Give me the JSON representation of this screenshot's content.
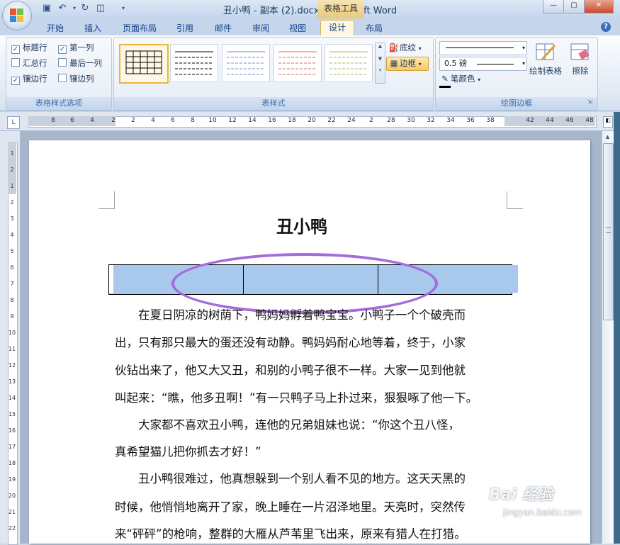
{
  "window": {
    "title": "丑小鸭 - 副本 (2).docx - Microsoft Word",
    "context_tab": "表格工具"
  },
  "ribbon_tabs": [
    {
      "label": "开始"
    },
    {
      "label": "插入"
    },
    {
      "label": "页面布局"
    },
    {
      "label": "引用"
    },
    {
      "label": "邮件"
    },
    {
      "label": "审阅"
    },
    {
      "label": "视图"
    },
    {
      "label": "设计"
    },
    {
      "label": "布局"
    }
  ],
  "active_tab": "设计",
  "groups": {
    "style_options": {
      "label": "表格样式选项",
      "checkboxes": [
        {
          "label": "标题行",
          "checked": "✓"
        },
        {
          "label": "第一列",
          "checked": "✓"
        },
        {
          "label": "汇总行",
          "checked": ""
        },
        {
          "label": "最后一列",
          "checked": ""
        },
        {
          "label": "镶边行",
          "checked": "✓"
        },
        {
          "label": "镶边列",
          "checked": ""
        }
      ]
    },
    "table_styles": {
      "label": "表样式",
      "shading": "底纹",
      "borders": "边框"
    },
    "draw_borders": {
      "label": "绘图边框",
      "line_weight": "0.5 磅",
      "pen_color": "笔颜色",
      "draw_table": "绘制表格",
      "eraser": "擦除"
    }
  },
  "ruler": {
    "h_numbers": [
      "8",
      "6",
      "4",
      "2",
      "2",
      "4",
      "6",
      "8",
      "10",
      "12",
      "14",
      "16",
      "18",
      "20",
      "22",
      "24",
      "2",
      "28",
      "30",
      "32",
      "34",
      "36",
      "38",
      "42",
      "44",
      "46",
      "48"
    ],
    "v_numbers": [
      "1",
      "2",
      "1",
      "2",
      "3",
      "4",
      "5",
      "6",
      "7",
      "8",
      "9",
      "10",
      "11",
      "12",
      "13",
      "14",
      "15",
      "16",
      "17",
      "18",
      "19",
      "20",
      "21",
      "22"
    ]
  },
  "document": {
    "heading": "丑小鸭",
    "table_columns": 3,
    "paragraphs": [
      "　　在夏日阴凉的树荫下，鸭妈妈孵着鸭宝宝。小鸭子一个个破壳而",
      "出，只有那只最大的蛋还没有动静。鸭妈妈耐心地等着，终于，小家",
      "伙钻出来了，他又大又丑，和别的小鸭子很不一样。大家一见到他就",
      "叫起来：“瞧，他多丑啊！”有一只鸭子马上扑过来，狠狠啄了他一下。",
      "　　大家都不喜欢丑小鸭，连他的兄弟姐妹也说：“你这个丑八怪，",
      "真希望猫儿把你抓去才好！”",
      "　　丑小鸭很难过，他真想躲到一个别人看不见的地方。这天天黑的",
      "时候，他悄悄地离开了家，晚上睡在一片沼泽地里。天亮时，突然传",
      "来“砰砰”的枪响，整群的大雁从芦苇里飞出来，原来有猎人在打猎。"
    ]
  },
  "watermark": {
    "logo": "Bai 经验",
    "url": "jingyan.baidu.com"
  },
  "colors": {
    "table_fill": "#a8c8ec",
    "highlight_ellipse": "#a36bdb",
    "active_button": "#f8c865"
  }
}
